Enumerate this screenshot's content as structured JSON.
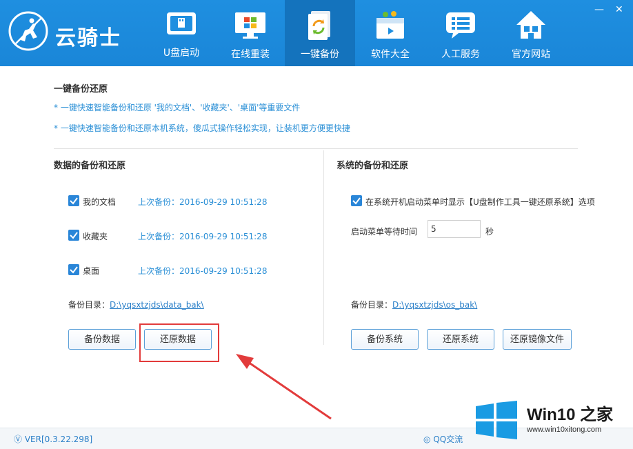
{
  "app": {
    "name": "云骑士",
    "window_controls": {
      "minimize": "—",
      "close": "✕"
    }
  },
  "nav": [
    {
      "label": "U盘启动",
      "icon": "usb-drive-icon",
      "active": false
    },
    {
      "label": "在线重装",
      "icon": "monitor-windows-icon",
      "active": false
    },
    {
      "label": "一键备份",
      "icon": "backup-sync-icon",
      "active": true
    },
    {
      "label": "软件大全",
      "icon": "software-box-icon",
      "active": false
    },
    {
      "label": "人工服务",
      "icon": "chat-service-icon",
      "active": false
    },
    {
      "label": "官方网站",
      "icon": "home-icon",
      "active": false
    }
  ],
  "intro": {
    "title": "一键备份还原",
    "tip1": "* 一键快速智能备份和还原 '我的文档'、'收藏夹'、'桌面'等重要文件",
    "tip2": "* 一键快速智能备份和还原本机系统，傻瓜式操作轻松实现，让装机更方便更快捷"
  },
  "data_backup": {
    "title": "数据的备份和还原",
    "items": [
      {
        "label": "我的文档",
        "checked": true,
        "last_backup": "上次备份：2016-09-29 10:51:28"
      },
      {
        "label": "收藏夹",
        "checked": true,
        "last_backup": "上次备份：2016-09-29 10:51:28"
      },
      {
        "label": "桌面",
        "checked": true,
        "last_backup": "上次备份：2016-09-29 10:51:28"
      }
    ],
    "dir_label": "备份目录：",
    "dir_path": "D:\\yqsxtzjds\\data_bak\\",
    "backup_button": "备份数据",
    "restore_button": "还原数据"
  },
  "system_backup": {
    "title": "系统的备份和还原",
    "boot_menu_option": "在系统开机启动菜单时显示【U盘制作工具一键还原系统】选项",
    "boot_menu_checked": true,
    "wait_label": "启动菜单等待时间",
    "wait_value": "5",
    "wait_unit": "秒",
    "dir_label": "备份目录：",
    "dir_path": "D:\\yqsxtzjds\\os_bak\\",
    "backup_button": "备份系统",
    "restore_button": "还原系统",
    "restore_image_button": "还原镜像文件"
  },
  "footer": {
    "version": "VER[0.3.22.298]",
    "qq": "QQ交流"
  },
  "watermark": {
    "title": "Win10 之家",
    "url": "www.win10xitong.com"
  },
  "colors": {
    "header_bg": "#1f8fe0",
    "nav_active_bg": "#1473bd",
    "accent_blue": "#2a86d8",
    "highlight_red": "#e23b3b"
  }
}
